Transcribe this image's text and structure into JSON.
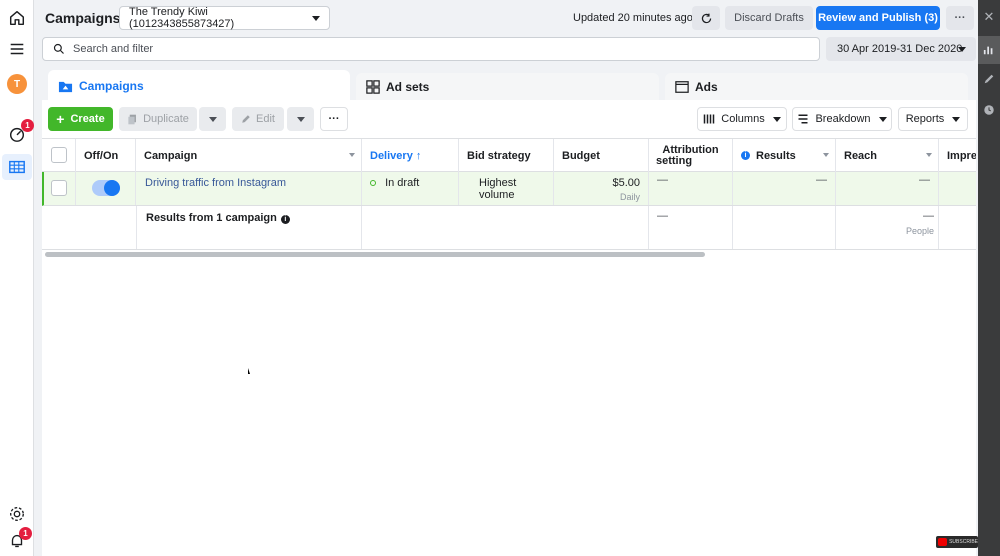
{
  "header": {
    "title": "Campaigns",
    "account": "The Trendy Kiwi (1012343855873427)",
    "updated": "Updated 20 minutes ago",
    "discard_label": "Discard Drafts",
    "publish_label": "Review and Publish (3)",
    "more_label": "···"
  },
  "search": {
    "placeholder": "Search and filter"
  },
  "date_range": "30 Apr 2019-31 Dec 2020",
  "rail": {
    "avatar_letter": "T",
    "notif_badge": "1",
    "bell_badge": "1"
  },
  "tabs": [
    {
      "label": "Campaigns"
    },
    {
      "label": "Ad sets"
    },
    {
      "label": "Ads"
    }
  ],
  "toolbar": {
    "create_label": "Create",
    "duplicate_label": "Duplicate",
    "edit_label": "Edit",
    "more_label": "···",
    "columns_label": "Columns",
    "breakdown_label": "Breakdown",
    "reports_label": "Reports"
  },
  "table": {
    "columns": {
      "offon": "Off/On",
      "campaign": "Campaign",
      "delivery": "Delivery ↑",
      "bid": "Bid strategy",
      "budget": "Budget",
      "attribution_1": "Attribution",
      "attribution_2": "setting",
      "results": "Results",
      "reach": "Reach",
      "impressions": "Impres"
    },
    "row": {
      "campaign": "Driving traffic from Instagram",
      "delivery": "In draft",
      "bid": "Highest volume",
      "budget": "$5.00",
      "budget_period": "Daily",
      "attribution": "—",
      "results": "—",
      "reach": "—"
    },
    "summary": {
      "label": "Results from 1 campaign",
      "attribution": "—",
      "reach": "—",
      "reach_sub": "People"
    }
  },
  "watermark": "SUBSCRIBE",
  "colors": {
    "brand_blue": "#1877f2",
    "create_green": "#42b72a",
    "draft_row": "#eff9ea"
  }
}
